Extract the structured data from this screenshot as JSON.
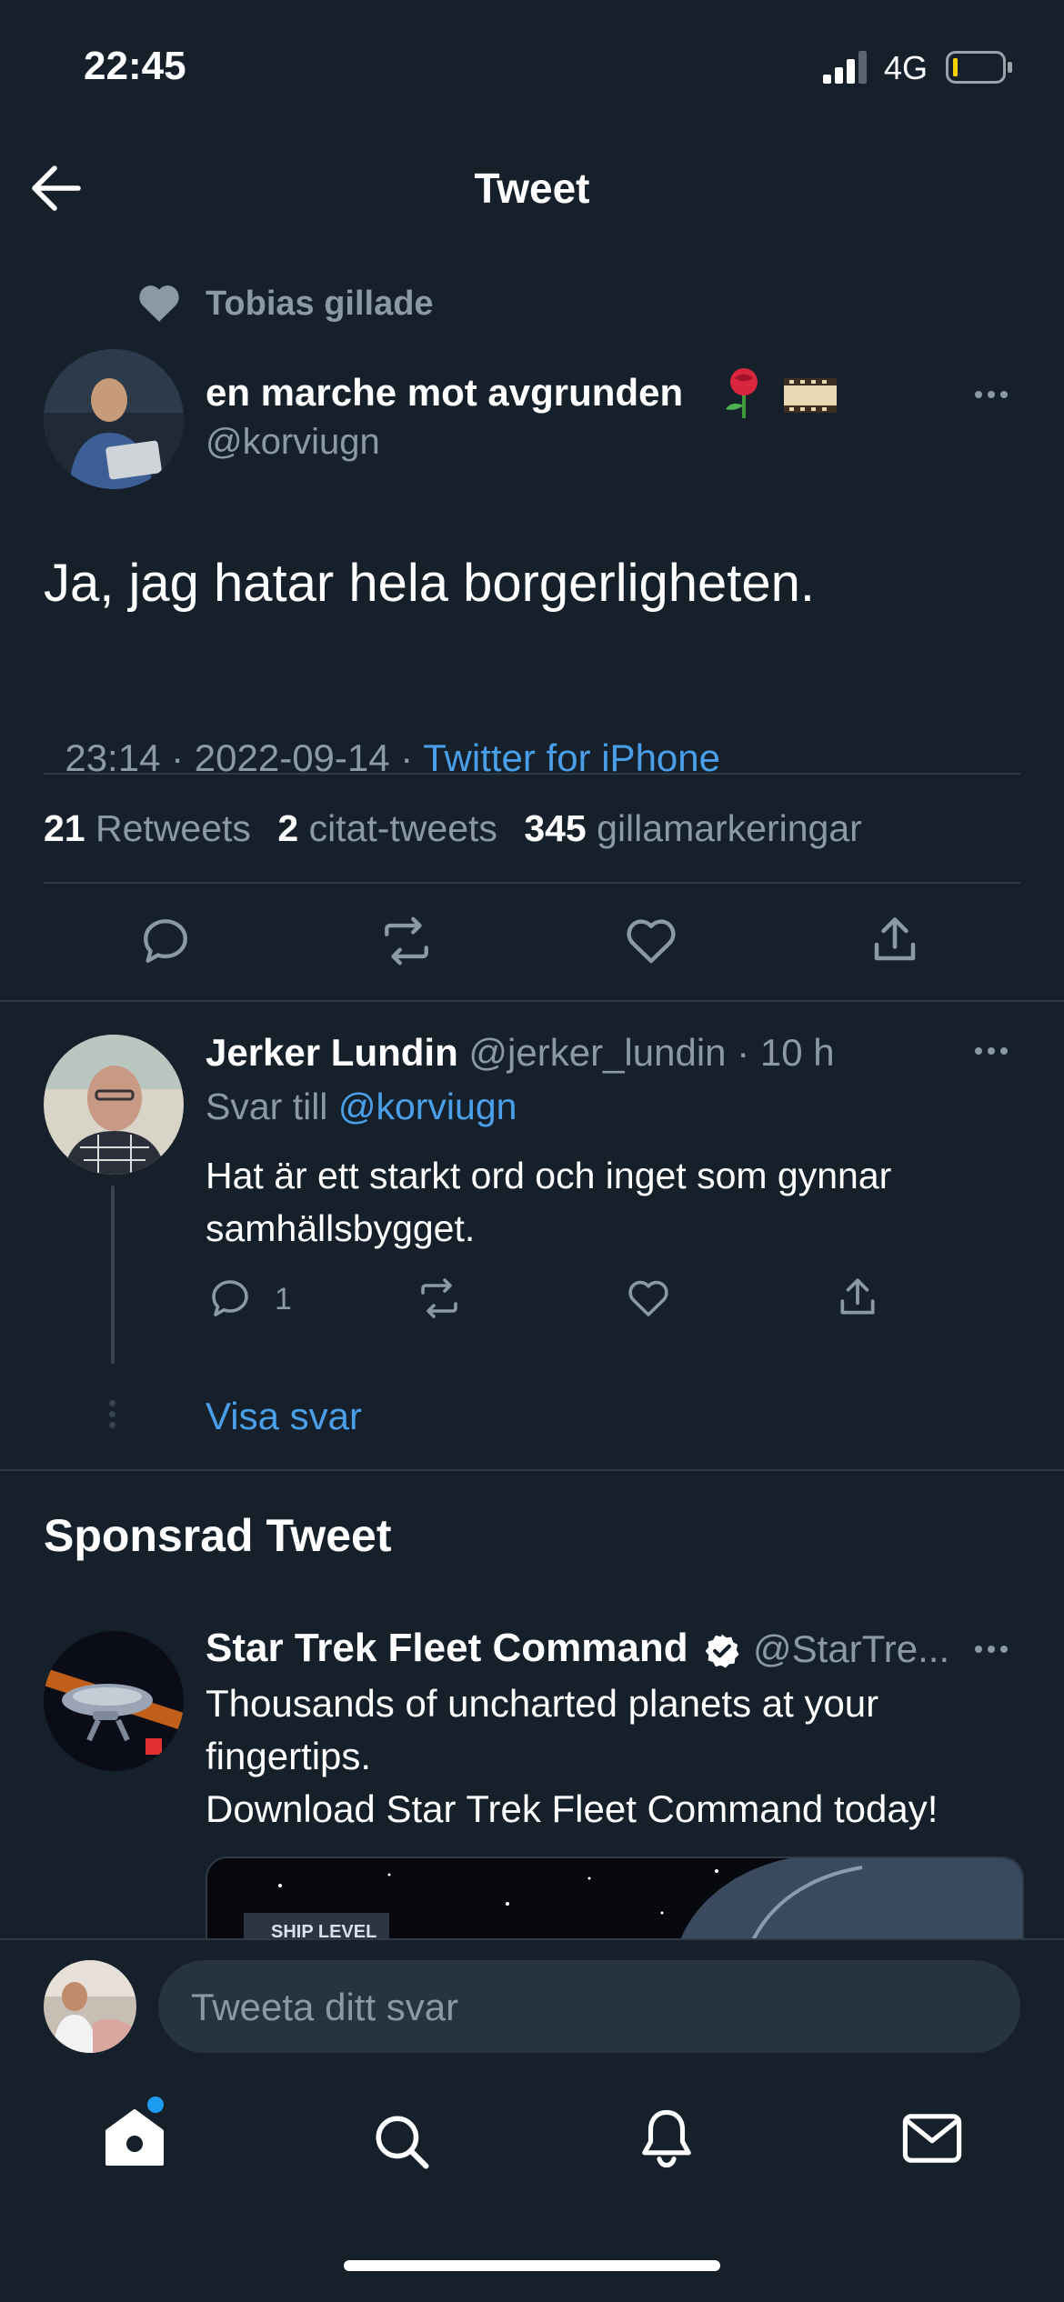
{
  "status_bar": {
    "time": "22:45",
    "network": "4G"
  },
  "header": {
    "title": "Tweet"
  },
  "liked_by": {
    "text": "Tobias gillade"
  },
  "tweet": {
    "display_name": "en marche mot avgrunden",
    "handle": "@korviugn",
    "text": "Ja, jag hatar hela borgerligheten.",
    "time": "23:14 · 2022-09-14 · ",
    "source": "Twitter for iPhone",
    "stats": {
      "retweets_count": "21",
      "retweets_label": "Retweets",
      "quotes_count": "2",
      "quotes_label": "citat-tweets",
      "likes_count": "345",
      "likes_label": "gillamarkeringar"
    }
  },
  "reply": {
    "display_name": "Jerker Lundin",
    "handle": "@jerker_lundin",
    "age": "· 10 h",
    "reply_prefix": "Svar till",
    "reply_to": "@korviugn",
    "text_line1": "Hat är ett starkt ord och inget som gynnar",
    "text_line2": "samhällsbygget.",
    "reply_count": "1",
    "show_replies": "Visa svar"
  },
  "sponsored": {
    "section_title": "Sponsrad Tweet",
    "display_name": "Star Trek Fleet Command",
    "handle": "@StarTre...",
    "text_line1": "Thousands of uncharted planets at your",
    "text_line2": "fingertips.",
    "text_line3": "Download Star Trek Fleet Command today!",
    "media_text": "SHIP LEVEL"
  },
  "composer": {
    "placeholder": "Tweeta ditt svar"
  },
  "colors": {
    "background": "#15202b",
    "accent": "#1d9bf0",
    "muted": "#8b98a5"
  }
}
